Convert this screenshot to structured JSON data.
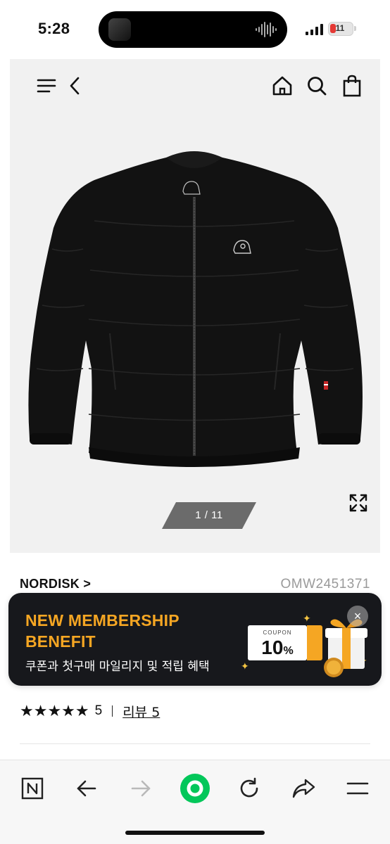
{
  "status_bar": {
    "time": "5:28",
    "battery_level": "11",
    "battery_color": "#e53935"
  },
  "header": {
    "icons": [
      "menu-icon",
      "back-icon",
      "home-icon",
      "search-icon",
      "cart-icon"
    ]
  },
  "gallery": {
    "counter": "1 / 11",
    "current": 1,
    "total": 11,
    "product_color": "#111111"
  },
  "product": {
    "brand": "NORDISK >",
    "code": "OMW2451371"
  },
  "banner": {
    "title_line1": "NEW MEMBERSHIP",
    "title_line2": "BENEFIT",
    "subtitle": "쿠폰과 첫구매 마일리지 및 적립 혜택",
    "coupon_label": "COUPON",
    "coupon_value": "10",
    "coupon_unit": "%",
    "close": "×",
    "accent_color": "#f5a623"
  },
  "rating": {
    "stars": "★★★★★",
    "score": "5",
    "review_label": "리뷰 5"
  },
  "browser_toolbar": {
    "icons": [
      "naver-icon",
      "back-arrow-icon",
      "forward-arrow-icon",
      "green-dot-icon",
      "reload-icon",
      "share-icon",
      "menu-icon"
    ],
    "accent_color": "#03c75a"
  }
}
